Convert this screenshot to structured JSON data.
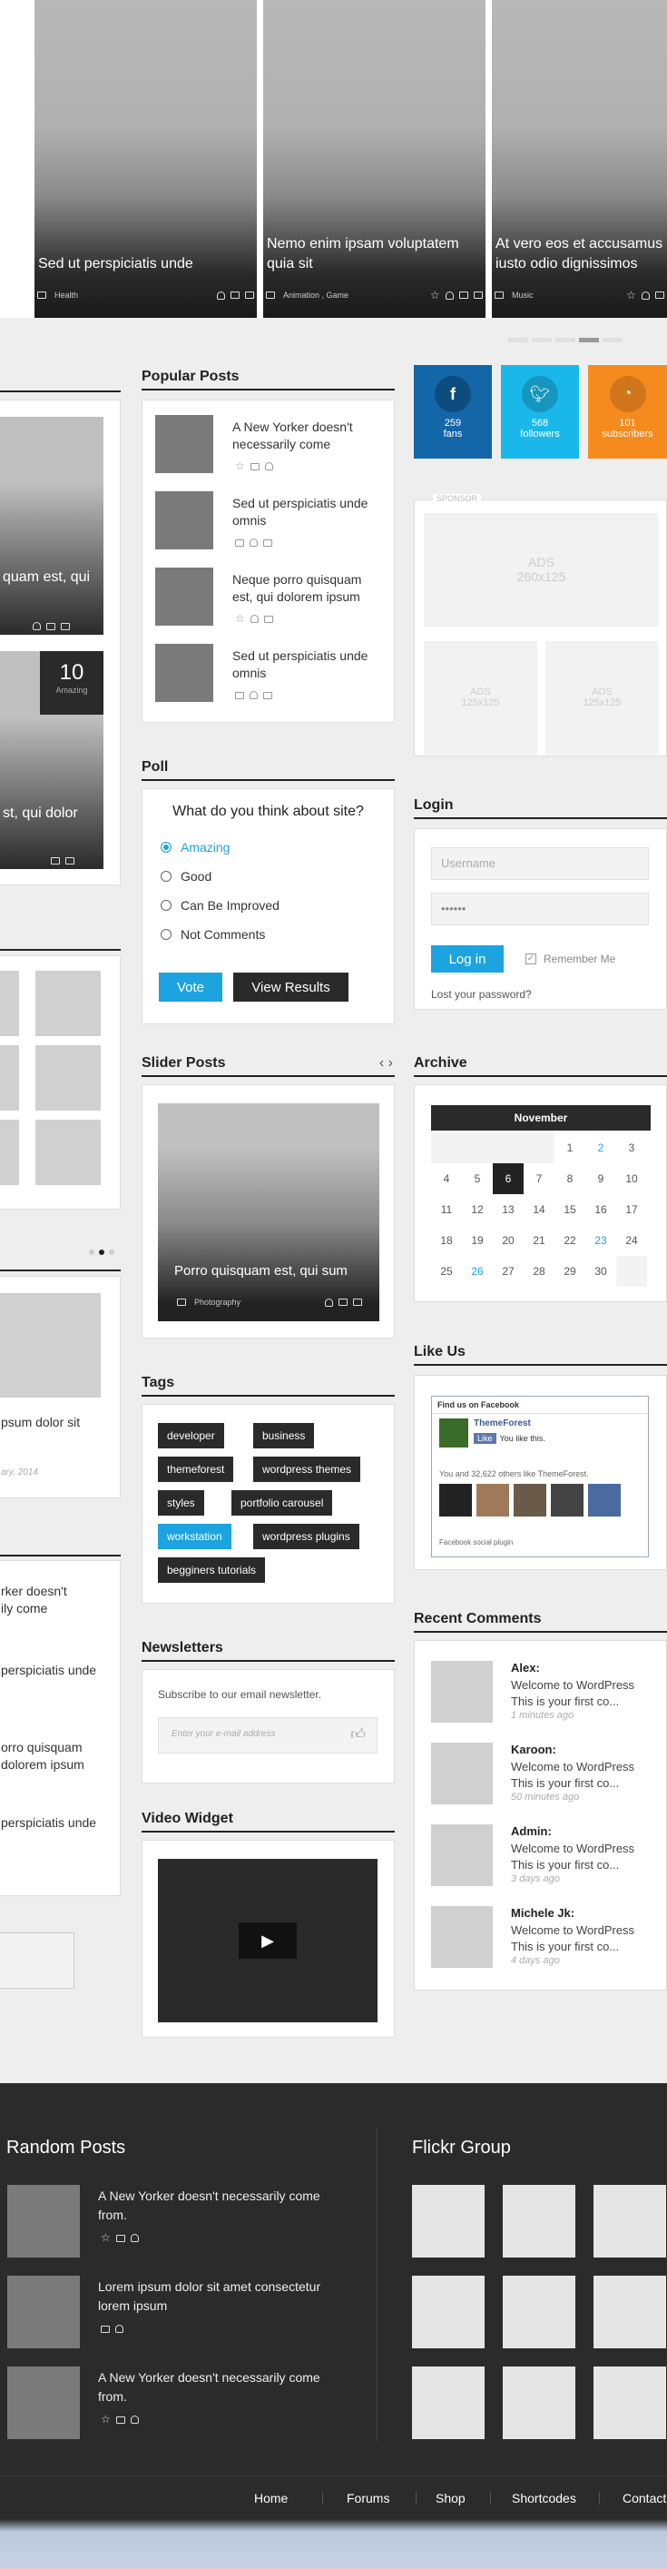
{
  "hero": {
    "slides": [
      {
        "title": "Sed ut perspiciatis unde",
        "category": "Health"
      },
      {
        "title": "Nemo enim ipsam voluptatem quia sit",
        "category": "Animation , Game"
      },
      {
        "title": "At vero eos et accusamus iusto odio dignissimos",
        "category": "Music"
      }
    ]
  },
  "left": {
    "big1_caption": "quam est, qui",
    "big2_caption": "st, qui dolor",
    "big2_count": "10",
    "big2_label": "Amazing",
    "small_caption": "psum dolor sit",
    "small_date": "ary, 2014",
    "list": [
      "rker doesn't",
      "ily come",
      "perspiciatis unde",
      "orro quisquam",
      "dolorem ipsum",
      "perspiciatis unde"
    ]
  },
  "popular": {
    "title": "Popular Posts",
    "items": [
      "A New Yorker doesn't necessarily come",
      "Sed ut perspiciatis unde omnis",
      "Neque porro quisquam est, qui dolorem ipsum",
      "Sed ut perspiciatis unde omnis"
    ]
  },
  "social": [
    {
      "count": "259",
      "label": "fans",
      "color": "#1366a8",
      "icon": "facebook-icon"
    },
    {
      "count": "568",
      "label": "followers",
      "color": "#1ab8ea",
      "icon": "twitter-icon"
    },
    {
      "count": "101",
      "label": "subscribers",
      "color": "#f58a1f",
      "icon": "rss-icon"
    }
  ],
  "sponsor": {
    "label": "SPONSOR",
    "big": "ADS",
    "big_size": "260x125",
    "small": "ADS",
    "small_size": "125x125"
  },
  "poll": {
    "title": "Poll",
    "question": "What do you think about site?",
    "options": [
      "Amazing",
      "Good",
      "Can Be Improved",
      "Not Comments"
    ],
    "vote": "Vote",
    "results": "View Results"
  },
  "login": {
    "title": "Login",
    "username": "Username",
    "password": "••••••",
    "button": "Log in",
    "remember": "Remember Me",
    "lost": "Lost your password?"
  },
  "slider": {
    "title": "Slider Posts",
    "caption": "Porro quisquam est, qui sum",
    "category": "Photography"
  },
  "archive": {
    "title": "Archive",
    "month": "November",
    "rows": [
      [
        "",
        "",
        "",
        "",
        "1",
        "2",
        "3"
      ],
      [
        "4",
        "5",
        "6",
        "7",
        "8",
        "9",
        "10"
      ],
      [
        "11",
        "12",
        "13",
        "14",
        "15",
        "16",
        "17"
      ],
      [
        "18",
        "19",
        "20",
        "21",
        "22",
        "23",
        "24"
      ],
      [
        "25",
        "26",
        "27",
        "28",
        "29",
        "30",
        ""
      ]
    ]
  },
  "tags": {
    "title": "Tags",
    "items": [
      "developer",
      "business",
      "themeforest",
      "wordpress themes",
      "styles",
      "portfolio carousel",
      "workstation",
      "wordpress plugins",
      "begginers tutorials"
    ]
  },
  "likeus": {
    "title": "Like Us",
    "find": "Find us on Facebook",
    "page": "ThemeForest",
    "like": "Like",
    "you_like": "You like this.",
    "line": "You and 32,622 others like ThemeForest.",
    "plugin": "Facebook social plugin"
  },
  "newsletter": {
    "title": "Newsletters",
    "text": "Subscribe to our email newsletter.",
    "placeholder": "Enter your e-mail address"
  },
  "video": {
    "title": "Video Widget"
  },
  "comments": {
    "title": "Recent Comments",
    "items": [
      {
        "name": "Alex:",
        "text": "Welcome to WordPress This is your first co...",
        "date": "1 minutes ago"
      },
      {
        "name": "Karoon:",
        "text": "Welcome to WordPress This is your first co...",
        "date": "50 minutes ago"
      },
      {
        "name": "Admin:",
        "text": "Welcome to WordPress This is your first co...",
        "date": "3 days ago"
      },
      {
        "name": "Michele Jk:",
        "text": "Welcome to WordPress This is your first co...",
        "date": "4 days ago"
      }
    ]
  },
  "footer": {
    "random_title": "Random Posts",
    "flickr_title": "Flickr Group",
    "random": [
      "A New Yorker doesn't necessarily come from.",
      "Lorem ipsum dolor sit amet consectetur lorem ipsum",
      "A New Yorker doesn't necessarily come from."
    ]
  },
  "nav": [
    "Home",
    "Forums",
    "Shop",
    "Shortcodes",
    "Contact"
  ]
}
